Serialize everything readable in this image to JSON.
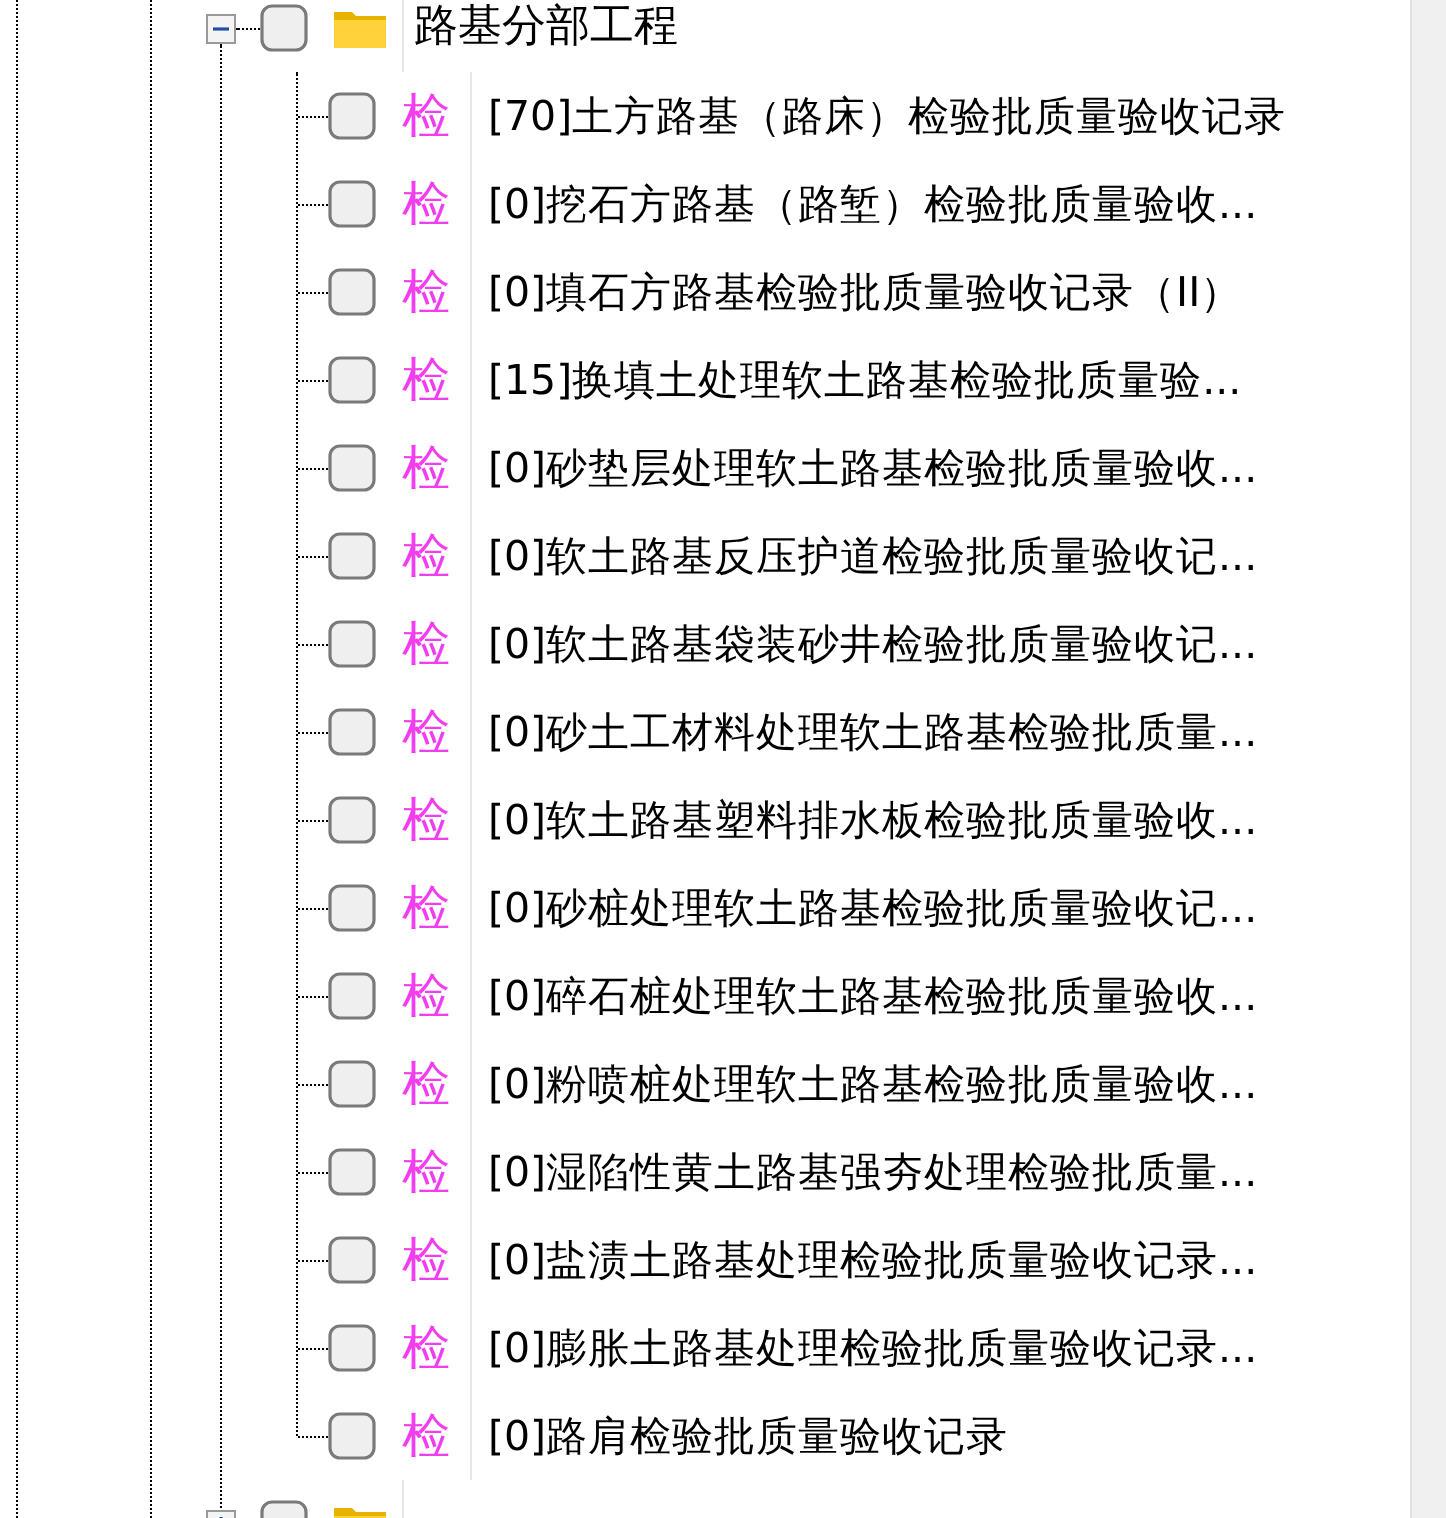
{
  "tree": {
    "label": "路基分部工程",
    "expanded": true,
    "checked": false,
    "children": [
      {
        "badge": "检",
        "label": "[70]土方路基（路床）检验批质量验收记录",
        "checked": false
      },
      {
        "badge": "检",
        "label": "[0]挖石方路基（路堑）检验批质量验收...",
        "checked": false
      },
      {
        "badge": "检",
        "label": "[0]填石方路基检验批质量验收记录（II）",
        "checked": false
      },
      {
        "badge": "检",
        "label": "[15]换填土处理软土路基检验批质量验...",
        "checked": false
      },
      {
        "badge": "检",
        "label": "[0]砂垫层处理软土路基检验批质量验收...",
        "checked": false
      },
      {
        "badge": "检",
        "label": "[0]软土路基反压护道检验批质量验收记...",
        "checked": false
      },
      {
        "badge": "检",
        "label": "[0]软土路基袋装砂井检验批质量验收记...",
        "checked": false
      },
      {
        "badge": "检",
        "label": "[0]砂土工材料处理软土路基检验批质量...",
        "checked": false
      },
      {
        "badge": "检",
        "label": "[0]软土路基塑料排水板检验批质量验收...",
        "checked": false
      },
      {
        "badge": "检",
        "label": "[0]砂桩处理软土路基检验批质量验收记...",
        "checked": false
      },
      {
        "badge": "检",
        "label": "[0]碎石桩处理软土路基检验批质量验收...",
        "checked": false
      },
      {
        "badge": "检",
        "label": "[0]粉喷桩处理软土路基检验批质量验收...",
        "checked": false
      },
      {
        "badge": "检",
        "label": "[0]湿陷性黄土路基强夯处理检验批质量...",
        "checked": false
      },
      {
        "badge": "检",
        "label": "[0]盐渍土路基处理检验批质量验收记录...",
        "checked": false
      },
      {
        "badge": "检",
        "label": "[0]膨胀土路基处理检验批质量验收记录...",
        "checked": false
      },
      {
        "badge": "检",
        "label": "[0]路肩检验批质量验收记录",
        "checked": false
      }
    ]
  },
  "next_node": {
    "expanded": false,
    "checked": false
  }
}
